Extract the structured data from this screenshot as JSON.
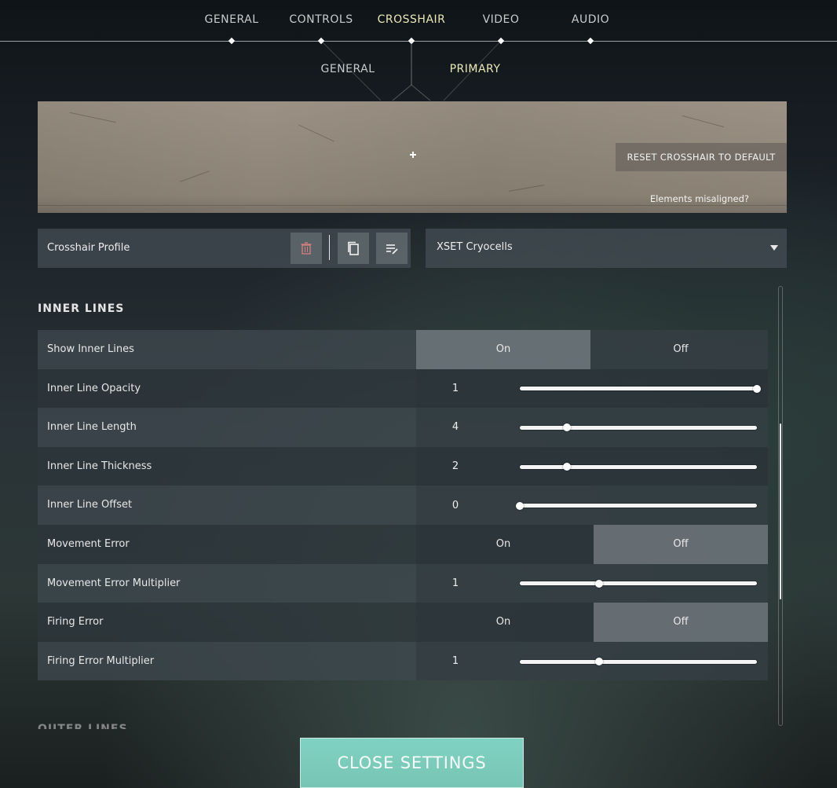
{
  "nav": {
    "tabs": [
      {
        "label": "GENERAL"
      },
      {
        "label": "CONTROLS"
      },
      {
        "label": "CROSSHAIR"
      },
      {
        "label": "VIDEO"
      },
      {
        "label": "AUDIO"
      }
    ],
    "active_tab": "CROSSHAIR"
  },
  "subnav": {
    "tabs": [
      {
        "label": "GENERAL"
      },
      {
        "label": "PRIMARY"
      }
    ],
    "active_tab": "PRIMARY"
  },
  "preview": {
    "reset_label": "RESET CROSSHAIR TO DEFAULT",
    "misaligned_label": "Elements misaligned?"
  },
  "profile": {
    "label": "Crosshair Profile",
    "selected": "XSET Cryocells",
    "icons": [
      "trash-icon",
      "copy-icon",
      "rename-icon"
    ]
  },
  "section": {
    "title": "INNER LINES",
    "rows": [
      {
        "label": "Show Inner Lines",
        "on_label": "On",
        "off_label": "Off",
        "value": "On"
      },
      {
        "label": "Inner Line Opacity",
        "value": "1",
        "fraction": 1.0
      },
      {
        "label": "Inner Line Length",
        "value": "4",
        "fraction": 0.2
      },
      {
        "label": "Inner Line Thickness",
        "value": "2",
        "fraction": 0.2
      },
      {
        "label": "Inner Line Offset",
        "value": "0",
        "fraction": 0.0
      },
      {
        "label": "Movement Error",
        "on_label": "On",
        "off_label": "Off",
        "value": "Off"
      },
      {
        "label": "Movement Error Multiplier",
        "value": "1",
        "fraction": 0.333
      },
      {
        "label": "Firing Error",
        "on_label": "On",
        "off_label": "Off",
        "value": "Off"
      },
      {
        "label": "Firing Error Multiplier",
        "value": "1",
        "fraction": 0.333
      }
    ],
    "next_title": "OUTER LINES"
  },
  "scroll": {
    "position_fraction": 0.43
  },
  "close_label": "CLOSE SETTINGS",
  "colors": {
    "accent": "#78c5b4",
    "active_tab": "#ece8b8"
  }
}
